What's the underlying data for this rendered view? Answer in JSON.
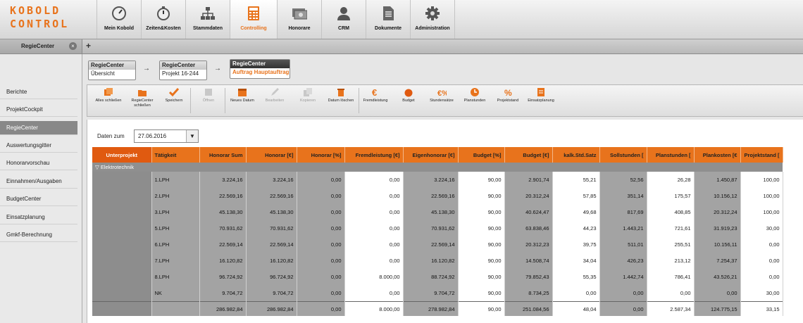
{
  "app": {
    "logo_line1": "KOBOLD",
    "logo_line2": "CONTROL",
    "accent": "#e8731c"
  },
  "nav": [
    {
      "label": "Mein Kobold",
      "icon": "gauge-icon"
    },
    {
      "label": "Zeiten&Kosten",
      "icon": "stopwatch-icon"
    },
    {
      "label": "Stammdaten",
      "icon": "org-chart-icon"
    },
    {
      "label": "Controlling",
      "icon": "calculator-icon",
      "active": true
    },
    {
      "label": "Honorare",
      "icon": "money-icon"
    },
    {
      "label": "CRM",
      "icon": "person-icon"
    },
    {
      "label": "Dokumente",
      "icon": "document-icon"
    },
    {
      "label": "Administration",
      "icon": "gear-icon"
    }
  ],
  "tab": {
    "label": "RegieCenter",
    "close": "×",
    "add": "+"
  },
  "sidebar": [
    "Berichte",
    "ProjektCockpit",
    "RegieCenter",
    "Auswertungsgitter",
    "Honorarvorschau",
    "Einnahmen/Ausgaben",
    "BudgetCenter",
    "Einsatzplanung",
    "Gmkf-Berechnung"
  ],
  "breadcrumb": [
    {
      "title": "RegieCenter",
      "sub": "Übersicht"
    },
    {
      "title": "RegieCenter",
      "sub": "Projekt 16-244"
    },
    {
      "title": "RegieCenter",
      "sub": "Auftrag Hauptauftrag"
    }
  ],
  "toolbar": [
    {
      "label": "Alles schließen",
      "icon": "close-all-icon"
    },
    {
      "label": "RegieCenter schließen",
      "icon": "folder-close-icon"
    },
    {
      "label": "Speichern",
      "icon": "checkmark-icon"
    },
    {
      "label": "Öffnen",
      "icon": "open-icon",
      "disabled": true
    },
    {
      "label": "Neues Datum",
      "icon": "new-date-icon"
    },
    {
      "label": "Bearbeiten",
      "icon": "pencil-icon",
      "disabled": true
    },
    {
      "label": "Kopieren",
      "icon": "copy-icon",
      "disabled": true
    },
    {
      "label": "Datum löschen",
      "icon": "trash-icon"
    },
    {
      "label": "Fremdleistung",
      "icon": "euro-icon"
    },
    {
      "label": "Budget",
      "icon": "budget-icon"
    },
    {
      "label": "Stundensätze",
      "icon": "rates-icon"
    },
    {
      "label": "Planstunden",
      "icon": "plan-hours-icon"
    },
    {
      "label": "Projektstand",
      "icon": "percent-icon"
    },
    {
      "label": "Einsatzplanung",
      "icon": "planning-icon"
    }
  ],
  "date": {
    "label": "Daten zum",
    "value": "27.06.2016"
  },
  "table": {
    "columns": [
      "Unterprojekt",
      "Tätigkeit",
      "Honorar Sum",
      "Honorar [€]",
      "Honorar [%]",
      "Fremdleistung [€]",
      "Eigenhonorar [€]",
      "Budget [%]",
      "Budget [€]",
      "kalk.Std.Satz",
      "Sollstunden [",
      "Planstunden [",
      "Plankosten [€",
      "Projektstand ["
    ],
    "group": "Elektrotechnik",
    "rows": [
      [
        "",
        "1.LPH",
        "3.224,16",
        "3.224,16",
        "0,00",
        "0,00",
        "3.224,16",
        "90,00",
        "2.901,74",
        "55,21",
        "52,56",
        "26,28",
        "1.450,87",
        "100,00"
      ],
      [
        "",
        "2.LPH",
        "22.569,16",
        "22.569,16",
        "0,00",
        "0,00",
        "22.569,16",
        "90,00",
        "20.312,24",
        "57,85",
        "351,14",
        "175,57",
        "10.156,12",
        "100,00"
      ],
      [
        "",
        "3.LPH",
        "45.138,30",
        "45.138,30",
        "0,00",
        "0,00",
        "45.138,30",
        "90,00",
        "40.624,47",
        "49,68",
        "817,69",
        "408,85",
        "20.312,24",
        "100,00"
      ],
      [
        "",
        "5.LPH",
        "70.931,62",
        "70.931,62",
        "0,00",
        "0,00",
        "70.931,62",
        "90,00",
        "63.838,46",
        "44,23",
        "1.443,21",
        "721,61",
        "31.919,23",
        "30,00"
      ],
      [
        "",
        "6.LPH",
        "22.569,14",
        "22.569,14",
        "0,00",
        "0,00",
        "22.569,14",
        "90,00",
        "20.312,23",
        "39,75",
        "511,01",
        "255,51",
        "10.156,11",
        "0,00"
      ],
      [
        "",
        "7.LPH",
        "16.120,82",
        "16.120,82",
        "0,00",
        "0,00",
        "16.120,82",
        "90,00",
        "14.508,74",
        "34,04",
        "426,23",
        "213,12",
        "7.254,37",
        "0,00"
      ],
      [
        "",
        "8.LPH",
        "96.724,92",
        "96.724,92",
        "0,00",
        "8.000,00",
        "88.724,92",
        "90,00",
        "79.852,43",
        "55,35",
        "1.442,74",
        "786,41",
        "43.526,21",
        "0,00"
      ],
      [
        "",
        "NK",
        "9.704,72",
        "9.704,72",
        "0,00",
        "0,00",
        "9.704,72",
        "90,00",
        "8.734,25",
        "0,00",
        "0,00",
        "0,00",
        "0,00",
        "30,00"
      ]
    ],
    "total": [
      "",
      "",
      "286.982,84",
      "286.982,84",
      "0,00",
      "8.000,00",
      "278.982,84",
      "90,00",
      "251.084,56",
      "48,04",
      "0,00",
      "2.587,34",
      "124.775,15",
      "33,15"
    ]
  }
}
